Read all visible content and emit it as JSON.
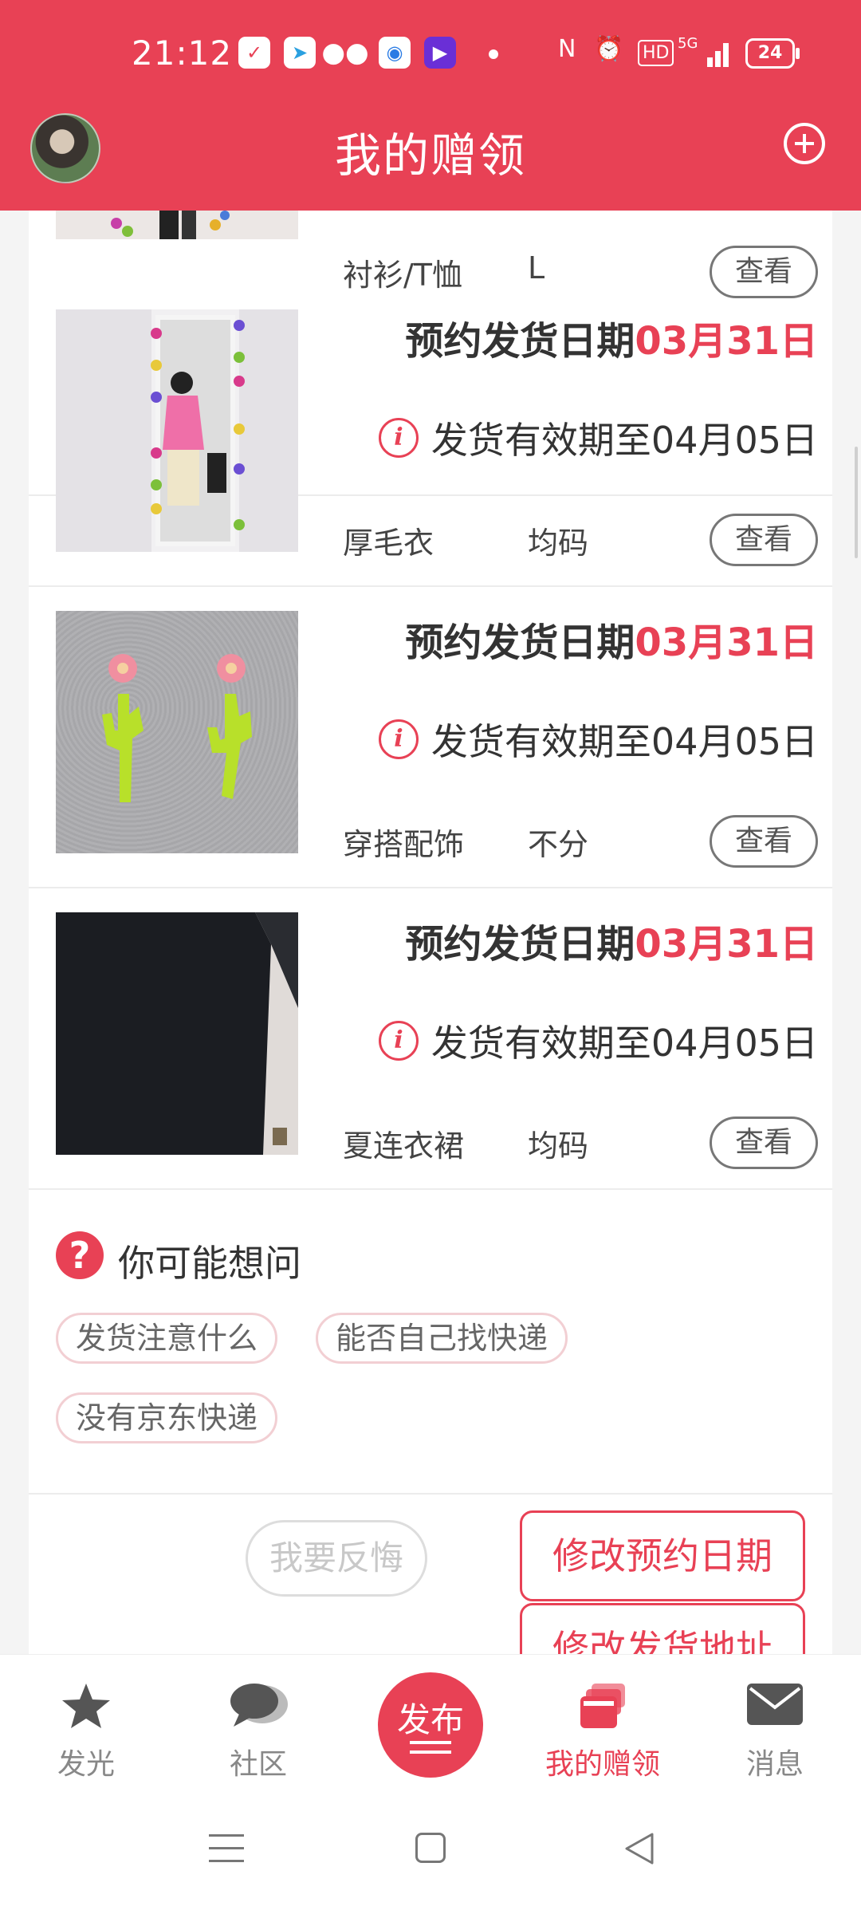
{
  "status_bar": {
    "time": "21:12",
    "network": "5G",
    "battery": "24"
  },
  "header": {
    "title": "我的赠领"
  },
  "items": [
    {
      "category": "衬衫/T恤",
      "size": "L",
      "view_label": "查看"
    },
    {
      "schedule_prefix": "预约发货日期",
      "schedule_date": "03月31日",
      "validity": "发货有效期至04月05日",
      "category": "厚毛衣",
      "size": "均码",
      "view_label": "查看"
    },
    {
      "schedule_prefix": "预约发货日期",
      "schedule_date": "03月31日",
      "validity": "发货有效期至04月05日",
      "category": "穿搭配饰",
      "size": "不分",
      "view_label": "查看"
    },
    {
      "schedule_prefix": "预约发货日期",
      "schedule_date": "03月31日",
      "validity": "发货有效期至04月05日",
      "category": "夏连衣裙",
      "size": "均码",
      "view_label": "查看"
    }
  ],
  "faq": {
    "title": "你可能想问",
    "chips": [
      "发货注意什么",
      "能否自己找快递",
      "没有京东快递"
    ]
  },
  "actions": {
    "regret": "我要反悔",
    "modify_date": "修改预约日期",
    "modify_address": "修改发货地址"
  },
  "bottom_nav": {
    "items": [
      {
        "label": "发光",
        "icon": "star-icon"
      },
      {
        "label": "社区",
        "icon": "chat-icon"
      },
      {
        "label": "发布",
        "icon": "publish-icon"
      },
      {
        "label": "我的赠领",
        "icon": "gift-cards-icon"
      },
      {
        "label": "消息",
        "icon": "mail-icon"
      }
    ],
    "active": "我的赠领"
  },
  "colors": {
    "brand": "#e84155",
    "text": "#333333",
    "muted": "#888888"
  }
}
